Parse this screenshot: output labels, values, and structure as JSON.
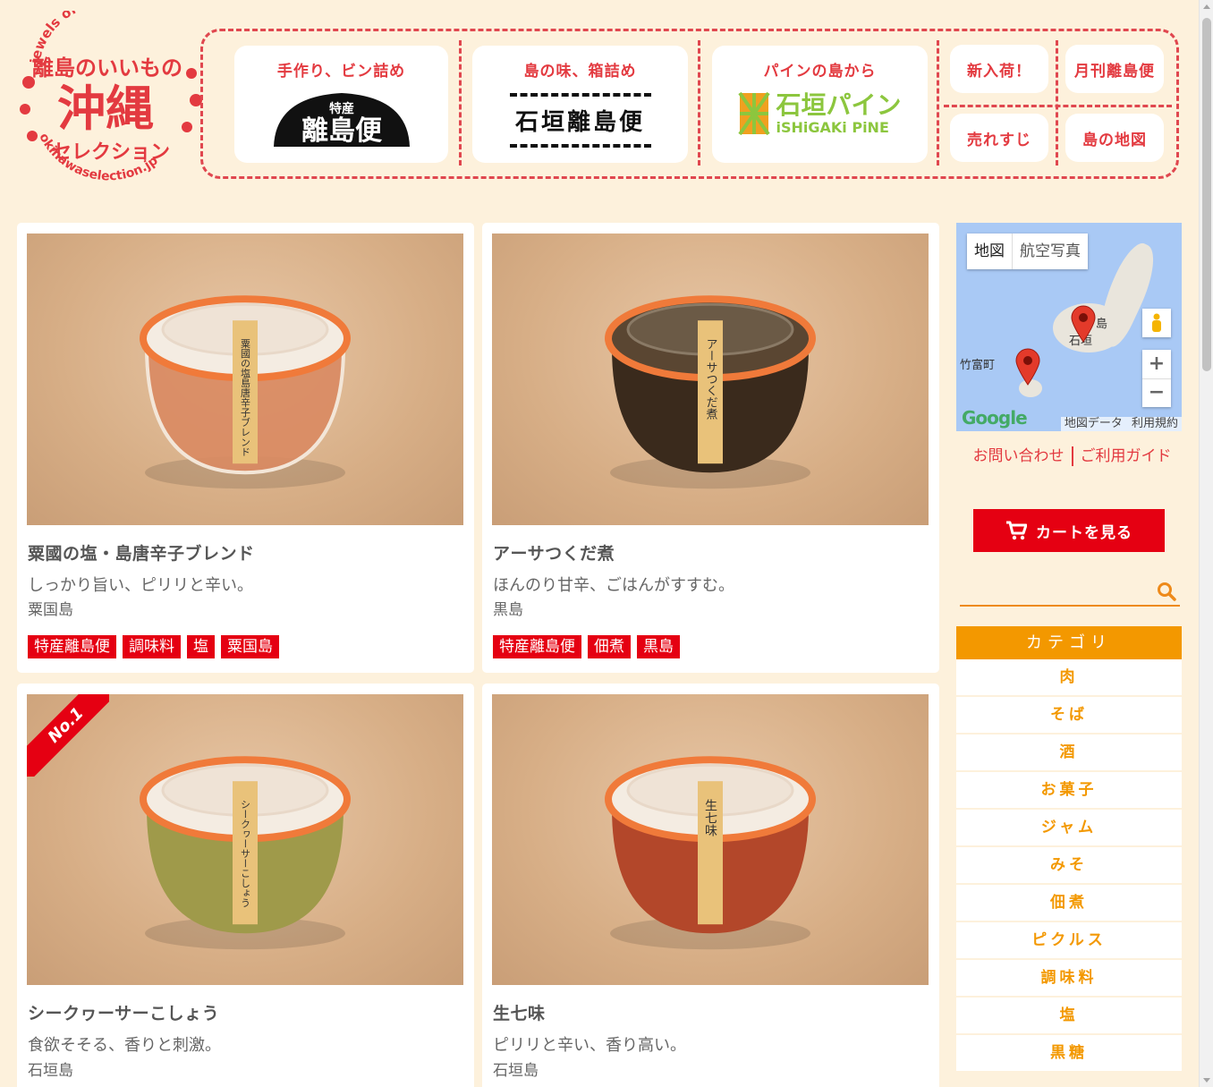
{
  "logo": {
    "top_arc": "jewels of islands",
    "line1": "離島のいいもの",
    "main": "沖縄",
    "line2": "セレクション",
    "url": "okinawaselection.jp"
  },
  "nav": {
    "card1": {
      "caption": "手作り、ビン詰め",
      "logo_small": "特産",
      "logo_main": "離島便"
    },
    "card2": {
      "caption": "島の味、箱詰め",
      "logo_main": "石垣離島便"
    },
    "card3": {
      "caption": "パインの島から",
      "logo_main": "石垣パイン",
      "logo_sub": "iSHiGAKi PiNE"
    },
    "new": "新入荷！",
    "monthly": "月刊離島便",
    "best": "売れすじ",
    "map": "島の地図"
  },
  "products": [
    {
      "title": "粟國の塩・島唐辛子ブレンド",
      "desc": "しっかり旨い、ピリリと辛い。",
      "island": "粟国島",
      "tags": [
        "特産離島便",
        "調味料",
        "塩",
        "粟国島"
      ],
      "jar_label": "粟國の塩島唐辛子ブレンド",
      "jar_color": "#d98a62"
    },
    {
      "title": "アーサつくだ煮",
      "desc": "ほんのり甘辛、ごはんがすすむ。",
      "island": "黒島",
      "tags": [
        "特産離島便",
        "佃煮",
        "黒島"
      ],
      "jar_label": "アーサつくだ煮",
      "jar_color": "#3a2a1c"
    },
    {
      "title": "シークヮーサーこしょう",
      "desc": "食欲そそる、香りと刺激。",
      "island": "石垣島",
      "tags": [],
      "jar_label": "シークヮーサーこしょう",
      "jar_color": "#9f9a4a",
      "ribbon": "No.1"
    },
    {
      "title": "生七味",
      "desc": "ピリリと辛い、香り高い。",
      "island": "石垣島",
      "tags": [],
      "jar_label": "生七味",
      "jar_color": "#b3472a"
    }
  ],
  "map": {
    "type_map": "地図",
    "type_aerial": "航空写真",
    "place1": "竹富町",
    "place2": "石垣",
    "place3": "島",
    "google": "Google",
    "credit_data": "地図データ",
    "credit_terms": "利用規約",
    "zoom_in": "+",
    "zoom_out": "−"
  },
  "sidebar": {
    "contact": "お問い合わせ",
    "guide": "ご利用ガイド",
    "cart": "カートを見る",
    "search_placeholder": "",
    "category_heading": "カテゴリ",
    "categories": [
      "肉",
      "そば",
      "酒",
      "お菓子",
      "ジャム",
      "みそ",
      "佃煮",
      "ピクルス",
      "調味料",
      "塩",
      "黒糖"
    ]
  },
  "colors": {
    "accent_red": "#e50012",
    "accent_orange": "#f39800",
    "background": "#fdf1dc"
  }
}
